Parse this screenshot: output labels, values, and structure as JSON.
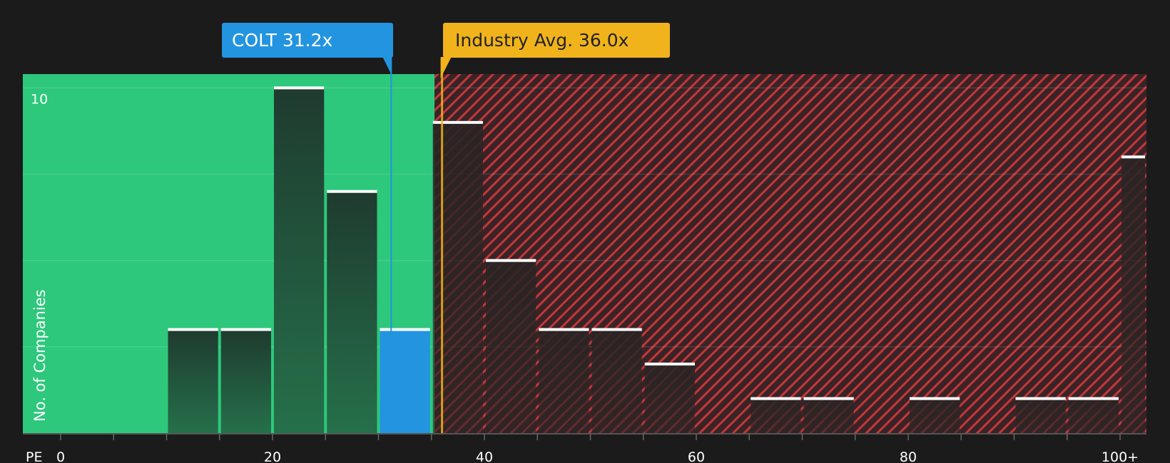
{
  "chart_data": {
    "type": "bar",
    "title": "",
    "xlabel": "PE",
    "ylabel": "No. of Companies",
    "xlim": [
      0,
      102
    ],
    "ylim": [
      0,
      10.4
    ],
    "x_ticks": [
      0,
      20,
      40,
      60,
      80,
      100
    ],
    "x_tick_labels": [
      "0",
      "20",
      "40",
      "60",
      "80",
      "100+"
    ],
    "y_tick_labels": [
      {
        "value": 10,
        "label": "10"
      }
    ],
    "y_gridlines": [
      2.5,
      5,
      7.5,
      10
    ],
    "bin_width": 5,
    "bins": [
      {
        "x0": 10,
        "x1": 15,
        "count": 3
      },
      {
        "x0": 15,
        "x1": 20,
        "count": 3
      },
      {
        "x0": 20,
        "x1": 25,
        "count": 10
      },
      {
        "x0": 25,
        "x1": 30,
        "count": 7
      },
      {
        "x0": 30,
        "x1": 35,
        "count": 3,
        "highlight": true
      },
      {
        "x0": 35,
        "x1": 40,
        "count": 9
      },
      {
        "x0": 40,
        "x1": 45,
        "count": 5
      },
      {
        "x0": 45,
        "x1": 50,
        "count": 3
      },
      {
        "x0": 50,
        "x1": 55,
        "count": 3
      },
      {
        "x0": 55,
        "x1": 60,
        "count": 2
      },
      {
        "x0": 65,
        "x1": 70,
        "count": 1
      },
      {
        "x0": 70,
        "x1": 75,
        "count": 1
      },
      {
        "x0": 80,
        "x1": 85,
        "count": 1
      },
      {
        "x0": 90,
        "x1": 95,
        "count": 1
      },
      {
        "x0": 95,
        "x1": 100,
        "count": 1
      },
      {
        "x0": 100,
        "x1": 102.5,
        "count": 8
      }
    ],
    "fair_region_end": 35.3,
    "company": {
      "label": "COLT 31.2x",
      "value": 31.2
    },
    "industry": {
      "label": "Industry Avg. 36.0x",
      "value": 36.0
    },
    "colors": {
      "background": "#1b1b1b",
      "good_region": "#2dc87b",
      "bad_region": "#3a2325",
      "hatch": "#c4373c",
      "company": "#2394e0",
      "industry": "#f0b31c",
      "bar_dark": "#1f3b2f",
      "bar_cap": "#ffffff"
    }
  }
}
